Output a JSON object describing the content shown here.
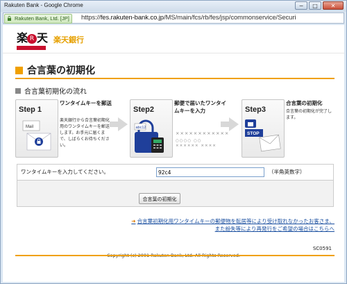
{
  "window": {
    "title": "Rakuten Bank - Google Chrome",
    "minimize": "−",
    "maximize": "□",
    "close": "✕"
  },
  "address_bar": {
    "secure_label": "Rakuten Bank, Ltd. [JP]",
    "url_scheme": "https://",
    "url_host": "fes.rakuten-bank.co.jp",
    "url_path": "/MS/main/fcs/rb/fes/jsp/commonservice/Securi"
  },
  "header": {
    "logo_kanji_1": "楽",
    "logo_r": "R",
    "logo_kanji_2": "天",
    "bank_name": "楽天銀行"
  },
  "page": {
    "title": "合言葉の初期化",
    "subtitle": "合言葉初期化の流れ"
  },
  "steps": [
    {
      "label": "Step 1",
      "title": "ワンタイムキーを郵送",
      "desc": "楽天銀行から合言葉初期化用のワンタイムキーを郵送します。お手元に届くまで、しばらくお待ちください。",
      "icon": "mail-icon",
      "mail_text": "Mail"
    },
    {
      "label": "Step2",
      "title": "郵便で届いたワンタイムキーを入力",
      "icon": "lock-keypad-icon",
      "tag_text": "abc12",
      "masked": "××××××××××××",
      "masked_small_1": "○○○○  ○○",
      "masked_small_2": "××××××  ××××"
    },
    {
      "label": "Step3",
      "title": "合言葉の初期化",
      "desc": "合言葉の初期化が完了します。",
      "icon": "stop-envelope-icon",
      "stop_text": "STOP"
    }
  ],
  "form": {
    "label": "ワンタイムキーを入力してください。",
    "value": "92c4",
    "note": "（半角英数字）",
    "submit_label": "合言葉の初期化"
  },
  "help_link": {
    "line1": "合言葉初期化用ワンタイムキーの郵便物を転居等により受け取れなかったお客さま、",
    "line2": "また紛失等により再発行をご希望の場合はこちらへ"
  },
  "footer": {
    "page_code": "SC0591",
    "copyright": "Copyright (c) 2001 Rakuten Bank, Ltd. All Rights Reserved."
  },
  "colors": {
    "accent": "#f0a000",
    "brand_red": "#c8102e",
    "link": "#1a4fa0"
  }
}
